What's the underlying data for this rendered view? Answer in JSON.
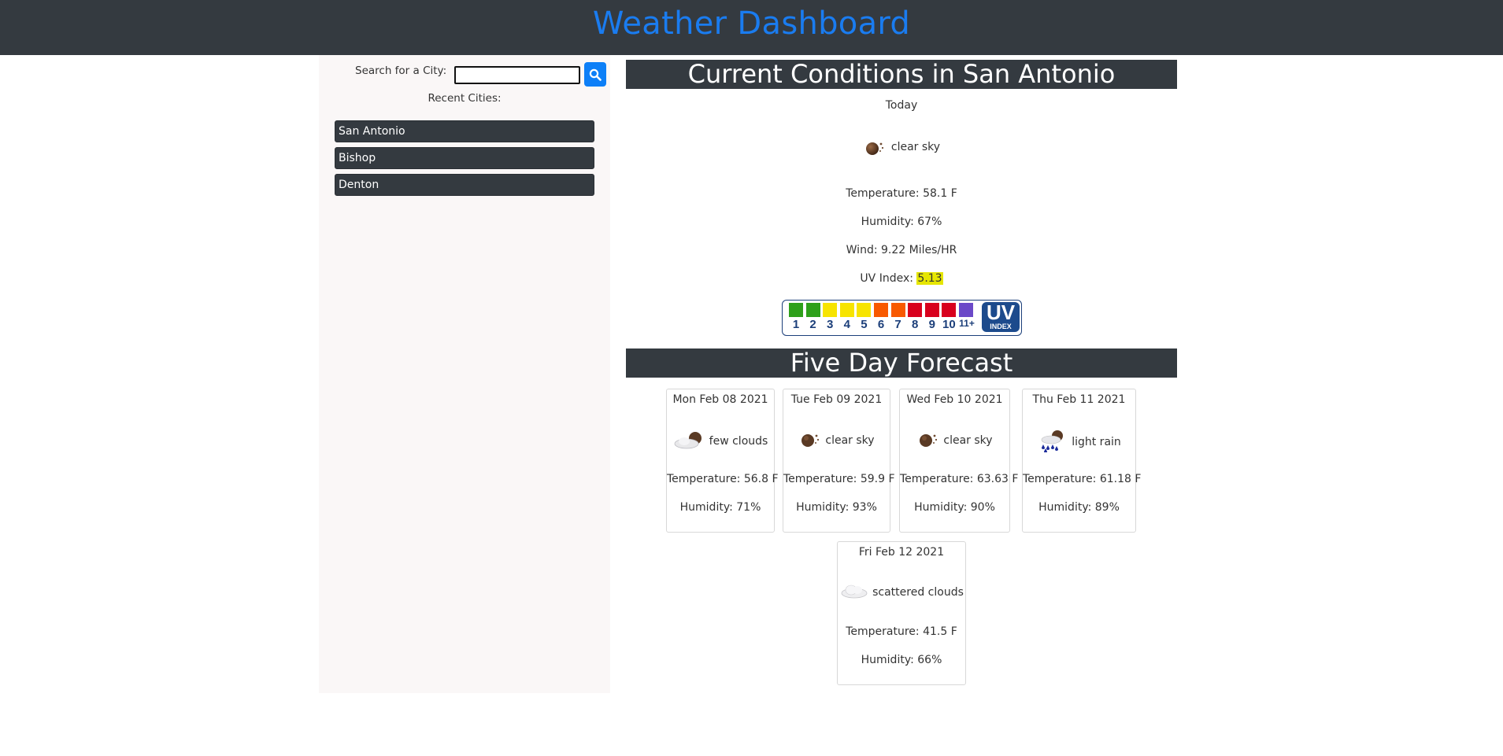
{
  "header": {
    "title": "Weather Dashboard"
  },
  "sidebar": {
    "search_label": "Search for a City:",
    "search_value": "",
    "search_placeholder": "",
    "recent_label": "Recent Cities:",
    "cities": [
      "San Antonio",
      "Bishop",
      "Denton"
    ]
  },
  "current": {
    "title": "Current Conditions in San Antonio",
    "day": "Today",
    "condition": "clear sky",
    "icon": "clear-sky-icon",
    "temperature": "Temperature: 58.1 F",
    "humidity": "Humidity: 67%",
    "wind": "Wind: 9.22 Miles/HR",
    "uv_label": "UV Index: ",
    "uv_value": "5.13",
    "uv_highlight_color": "#e6e600"
  },
  "uv_scale": {
    "labels": [
      "1",
      "2",
      "3",
      "4",
      "5",
      "6",
      "7",
      "8",
      "9",
      "10",
      "11+"
    ],
    "colors": [
      "#2ea01a",
      "#2ea01a",
      "#f7e400",
      "#f7e400",
      "#f7e400",
      "#f85900",
      "#f85900",
      "#d8001d",
      "#d8001d",
      "#d8001d",
      "#6b49c8"
    ],
    "badge_big": "UV",
    "badge_small": "INDEX"
  },
  "forecast": {
    "title": "Five Day Forecast",
    "days": [
      {
        "date": "Mon Feb 08 2021",
        "condition": "few clouds",
        "icon": "few-clouds-icon",
        "temperature": "Temperature: 56.8 F",
        "humidity": "Humidity: 71%"
      },
      {
        "date": "Tue Feb 09 2021",
        "condition": "clear sky",
        "icon": "clear-sky-icon",
        "temperature": "Temperature: 59.9 F",
        "humidity": "Humidity: 93%"
      },
      {
        "date": "Wed Feb 10 2021",
        "condition": "clear sky",
        "icon": "clear-sky-icon",
        "temperature": "Temperature: 63.63 F",
        "humidity": "Humidity: 90%"
      },
      {
        "date": "Thu Feb 11 2021",
        "condition": "light rain",
        "icon": "light-rain-icon",
        "temperature": "Temperature: 61.18 F",
        "humidity": "Humidity: 89%"
      },
      {
        "date": "Fri Feb 12 2021",
        "condition": "scattered clouds",
        "icon": "scattered-clouds-icon",
        "temperature": "Temperature: 41.5 F",
        "humidity": "Humidity: 66%"
      }
    ]
  },
  "colors": {
    "header_bg": "#343a40",
    "title_blue": "#1a7cf0",
    "search_button": "#0d7ff7",
    "sidebar_bg": "#faf7f7"
  }
}
